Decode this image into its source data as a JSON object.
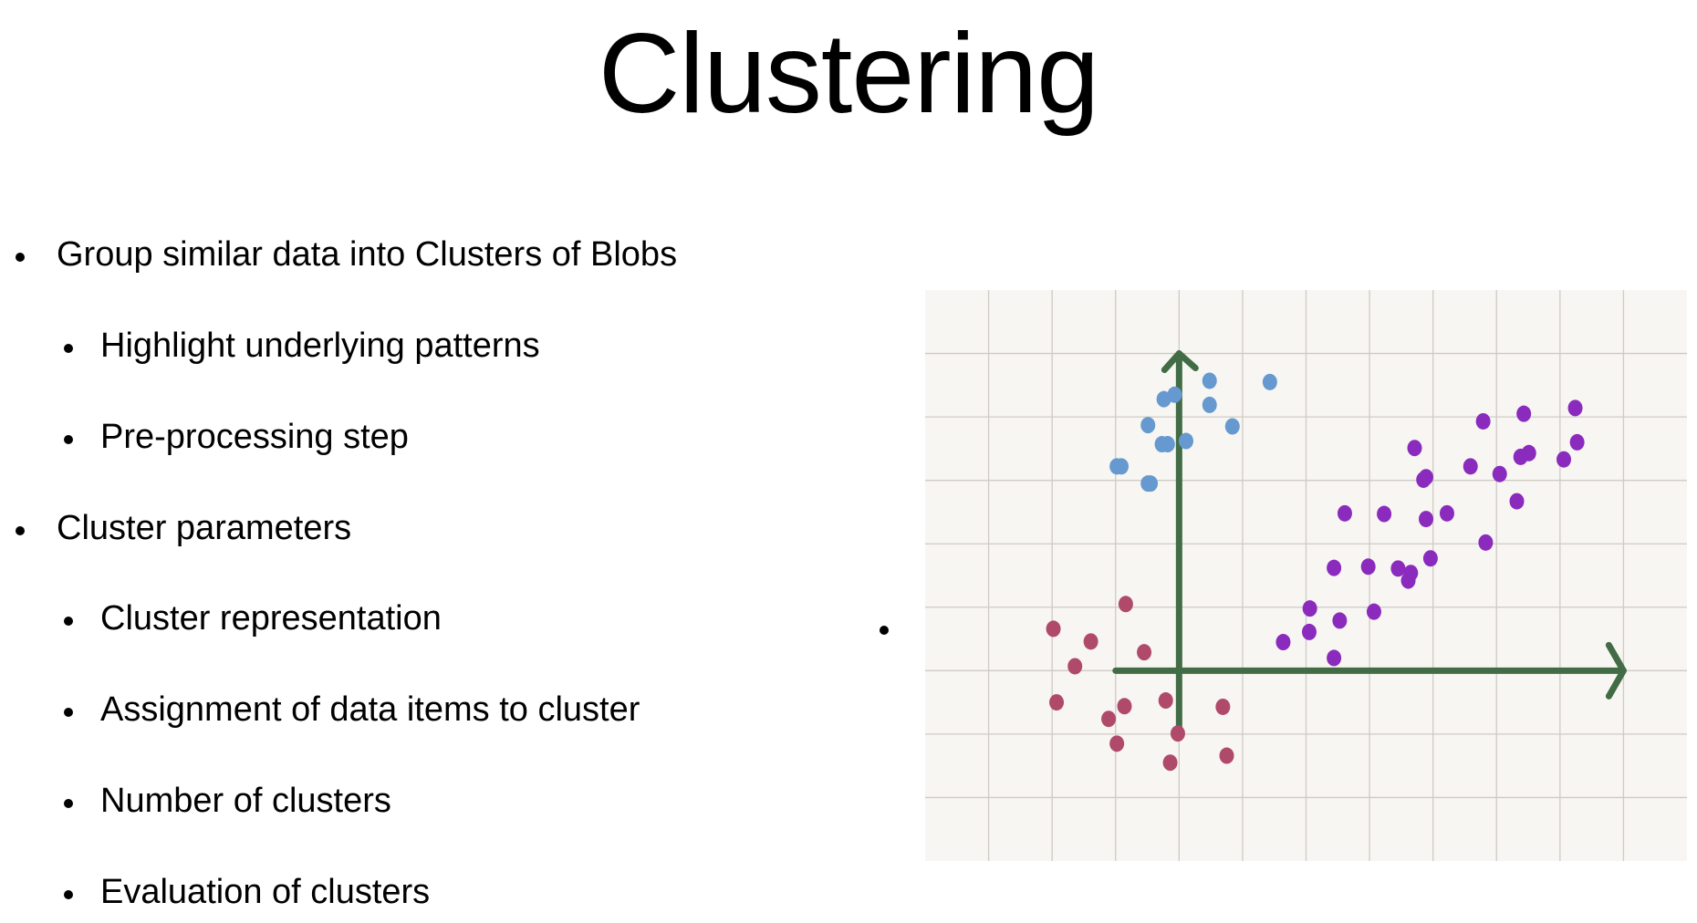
{
  "slide": {
    "title": "Clustering",
    "bullets": [
      {
        "level": 1,
        "text": "Group similar data into Clusters of Blobs"
      },
      {
        "level": 2,
        "text": "Highlight underlying patterns"
      },
      {
        "level": 2,
        "text": "Pre-processing step"
      },
      {
        "level": 1,
        "text": "Cluster parameters"
      },
      {
        "level": 2,
        "text": "Cluster representation"
      },
      {
        "level": 2,
        "text": "Assignment of data items to cluster"
      },
      {
        "level": 2,
        "text": "Number of clusters"
      },
      {
        "level": 2,
        "text": "Evaluation of clusters"
      }
    ]
  },
  "chart_data": {
    "type": "scatter",
    "title": "",
    "xlabel": "",
    "ylabel": "",
    "grid": true,
    "xlim": [
      -4,
      8
    ],
    "ylim": [
      -3,
      6
    ],
    "axes_arrows": {
      "x": [
        -1,
        7
      ],
      "y": [
        -0.9,
        5
      ]
    },
    "colors": {
      "background": "#f8f6f2",
      "grid": "#cfcac4",
      "axes": "#416c45"
    },
    "series": [
      {
        "color": "#6699cf",
        "points": [
          [
            0.48,
            4.57
          ],
          [
            1.43,
            4.55
          ],
          [
            -0.24,
            4.28
          ],
          [
            -0.07,
            4.35
          ],
          [
            0.48,
            4.19
          ],
          [
            -0.49,
            3.87
          ],
          [
            0.84,
            3.85
          ],
          [
            -0.27,
            3.57
          ],
          [
            -0.18,
            3.57
          ],
          [
            0.11,
            3.62
          ],
          [
            -0.98,
            3.22
          ],
          [
            -0.91,
            3.22
          ],
          [
            -0.49,
            2.95
          ],
          [
            -0.45,
            2.95
          ]
        ]
      },
      {
        "color": "#8a2bbe",
        "points": [
          [
            4.79,
            3.93
          ],
          [
            5.43,
            4.05
          ],
          [
            6.24,
            4.14
          ],
          [
            3.71,
            3.51
          ],
          [
            6.27,
            3.6
          ],
          [
            4.59,
            3.22
          ],
          [
            5.38,
            3.37
          ],
          [
            5.51,
            3.43
          ],
          [
            6.06,
            3.33
          ],
          [
            3.89,
            3.05
          ],
          [
            3.85,
            3.01
          ],
          [
            5.05,
            3.1
          ],
          [
            5.32,
            2.67
          ],
          [
            2.61,
            2.48
          ],
          [
            3.23,
            2.47
          ],
          [
            3.89,
            2.39
          ],
          [
            4.22,
            2.48
          ],
          [
            4.83,
            2.02
          ],
          [
            2.44,
            1.62
          ],
          [
            2.98,
            1.64
          ],
          [
            3.45,
            1.61
          ],
          [
            3.65,
            1.54
          ],
          [
            3.61,
            1.42
          ],
          [
            3.96,
            1.77
          ],
          [
            2.06,
            0.98
          ],
          [
            3.07,
            0.93
          ],
          [
            2.53,
            0.79
          ],
          [
            2.05,
            0.61
          ],
          [
            1.64,
            0.45
          ],
          [
            2.44,
            0.2
          ]
        ]
      },
      {
        "color": "#b04a6a",
        "points": [
          [
            -0.84,
            1.05
          ],
          [
            -1.98,
            0.66
          ],
          [
            -1.39,
            0.46
          ],
          [
            -0.55,
            0.29
          ],
          [
            -1.64,
            0.07
          ],
          [
            -1.93,
            -0.5
          ],
          [
            -0.86,
            -0.56
          ],
          [
            -0.21,
            -0.47
          ],
          [
            0.69,
            -0.57
          ],
          [
            -1.11,
            -0.76
          ],
          [
            -0.02,
            -0.99
          ],
          [
            -0.98,
            -1.15
          ],
          [
            -0.14,
            -1.45
          ],
          [
            0.75,
            -1.34
          ]
        ]
      }
    ]
  }
}
